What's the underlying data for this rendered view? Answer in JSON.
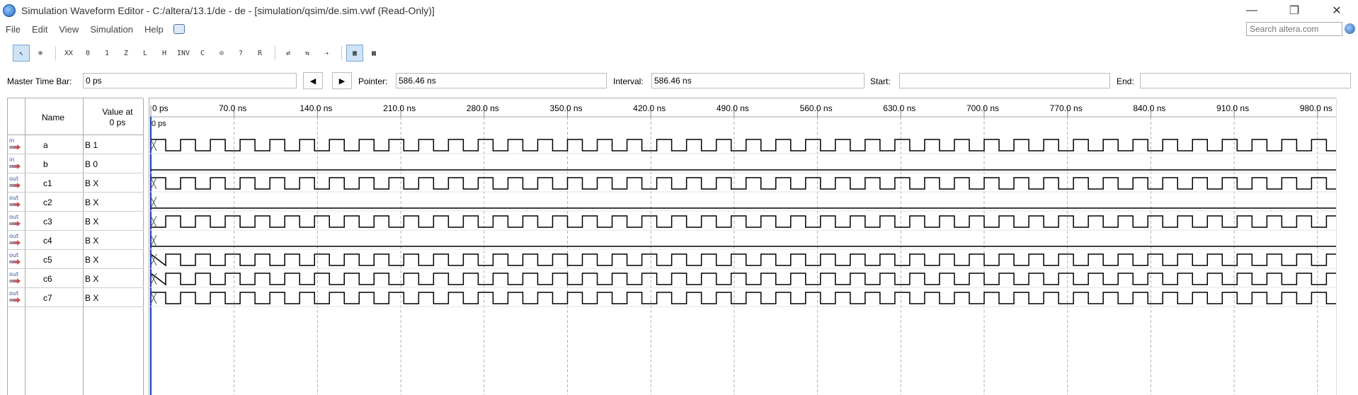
{
  "window": {
    "title": "Simulation Waveform Editor - C:/altera/13.1/de - de - [simulation/qsim/de.sim.vwf (Read-Only)]",
    "controls": [
      "—",
      "❐",
      "✕"
    ]
  },
  "menu": {
    "items": [
      "File",
      "Edit",
      "View",
      "Simulation",
      "Help"
    ],
    "search_placeholder": "Search altera.com"
  },
  "toolbar": {
    "buttons": [
      {
        "name": "selection-tool",
        "glyph": "↖",
        "active": true
      },
      {
        "name": "zoom-tool",
        "glyph": "⊕",
        "active": false
      },
      {
        "name": "force-unknown",
        "glyph": "XX",
        "active": false
      },
      {
        "name": "force-low",
        "glyph": "0",
        "active": false
      },
      {
        "name": "force-high",
        "glyph": "1",
        "active": false
      },
      {
        "name": "force-high-impedance",
        "glyph": "Z",
        "active": false
      },
      {
        "name": "force-weak-low",
        "glyph": "L",
        "active": false
      },
      {
        "name": "force-weak-high",
        "glyph": "H",
        "active": false
      },
      {
        "name": "invert",
        "glyph": "INV",
        "active": false
      },
      {
        "name": "count-value",
        "glyph": "C",
        "active": false
      },
      {
        "name": "overwrite-clock",
        "glyph": "⊙",
        "active": false
      },
      {
        "name": "arbitrary-value",
        "glyph": "?",
        "active": false
      },
      {
        "name": "random-value",
        "glyph": "R",
        "active": false
      },
      {
        "name": "run-functional-sim",
        "glyph": "⇄",
        "active": false
      },
      {
        "name": "run-timing-sim",
        "glyph": "⇆",
        "active": false
      },
      {
        "name": "generate-netlist",
        "glyph": "⇢",
        "active": false
      },
      {
        "name": "snap-to-grid",
        "glyph": "▦",
        "active": true
      },
      {
        "name": "grouping",
        "glyph": "▩",
        "active": false
      }
    ]
  },
  "timebar": {
    "master_label": "Master Time Bar:",
    "master_value": "0 ps",
    "prev_glyph": "◀",
    "next_glyph": "▶",
    "pointer_label": "Pointer:",
    "pointer_value": "586.46 ns",
    "interval_label": "Interval:",
    "interval_value": "586.46 ns",
    "start_label": "Start:",
    "start_value": "",
    "end_label": "End:",
    "end_value": ""
  },
  "signal_table": {
    "name_header": "Name",
    "value_header_line1": "Value at",
    "value_header_line2": "0 ps",
    "signals": [
      {
        "dir": "in",
        "name": "a",
        "value": "B 1"
      },
      {
        "dir": "in",
        "name": "b",
        "value": "B 0"
      },
      {
        "dir": "out",
        "name": "c1",
        "value": "B X"
      },
      {
        "dir": "out",
        "name": "c2",
        "value": "B X"
      },
      {
        "dir": "out",
        "name": "c3",
        "value": "B X"
      },
      {
        "dir": "out",
        "name": "c4",
        "value": "B X"
      },
      {
        "dir": "out",
        "name": "c5",
        "value": "B X"
      },
      {
        "dir": "out",
        "name": "c6",
        "value": "B X"
      },
      {
        "dir": "out",
        "name": "c7",
        "value": "B X"
      }
    ]
  },
  "waveform": {
    "time_ticks": [
      "0 ps",
      "70.0 ns",
      "140.0 ns",
      "210.0 ns",
      "280.0 ns",
      "350.0 ns",
      "420.0 ns",
      "490.0 ns",
      "560.0 ns",
      "630.0 ns",
      "700.0 ns",
      "770.0 ns",
      "840.0 ns",
      "910.0 ns",
      "980.0 ns"
    ],
    "time_start_ns": 0,
    "time_end_ns": 1000,
    "cursor_label": "0 ps",
    "cursor_ns": 0,
    "clock_period_ns": 25,
    "cursor_color": "#1a3db5",
    "grid_color": "#b0b0b0",
    "signals": [
      {
        "name": "a",
        "kind": "clock",
        "initial": "X0",
        "phase_ns": 0
      },
      {
        "name": "b",
        "kind": "low",
        "initial": "0"
      },
      {
        "name": "c1",
        "kind": "clock",
        "initial": "X",
        "phase_ns": 0
      },
      {
        "name": "c2",
        "kind": "low",
        "initial": "X"
      },
      {
        "name": "c3",
        "kind": "inverted-clock",
        "initial": "X",
        "phase_ns": 0
      },
      {
        "name": "c4",
        "kind": "low",
        "initial": "X"
      },
      {
        "name": "c5",
        "kind": "clock",
        "initial": "X",
        "phase_ns": 12.5
      },
      {
        "name": "c6",
        "kind": "clock",
        "initial": "X",
        "phase_ns": 12.5
      },
      {
        "name": "c7",
        "kind": "clock",
        "initial": "X",
        "phase_ns": 0
      }
    ]
  }
}
